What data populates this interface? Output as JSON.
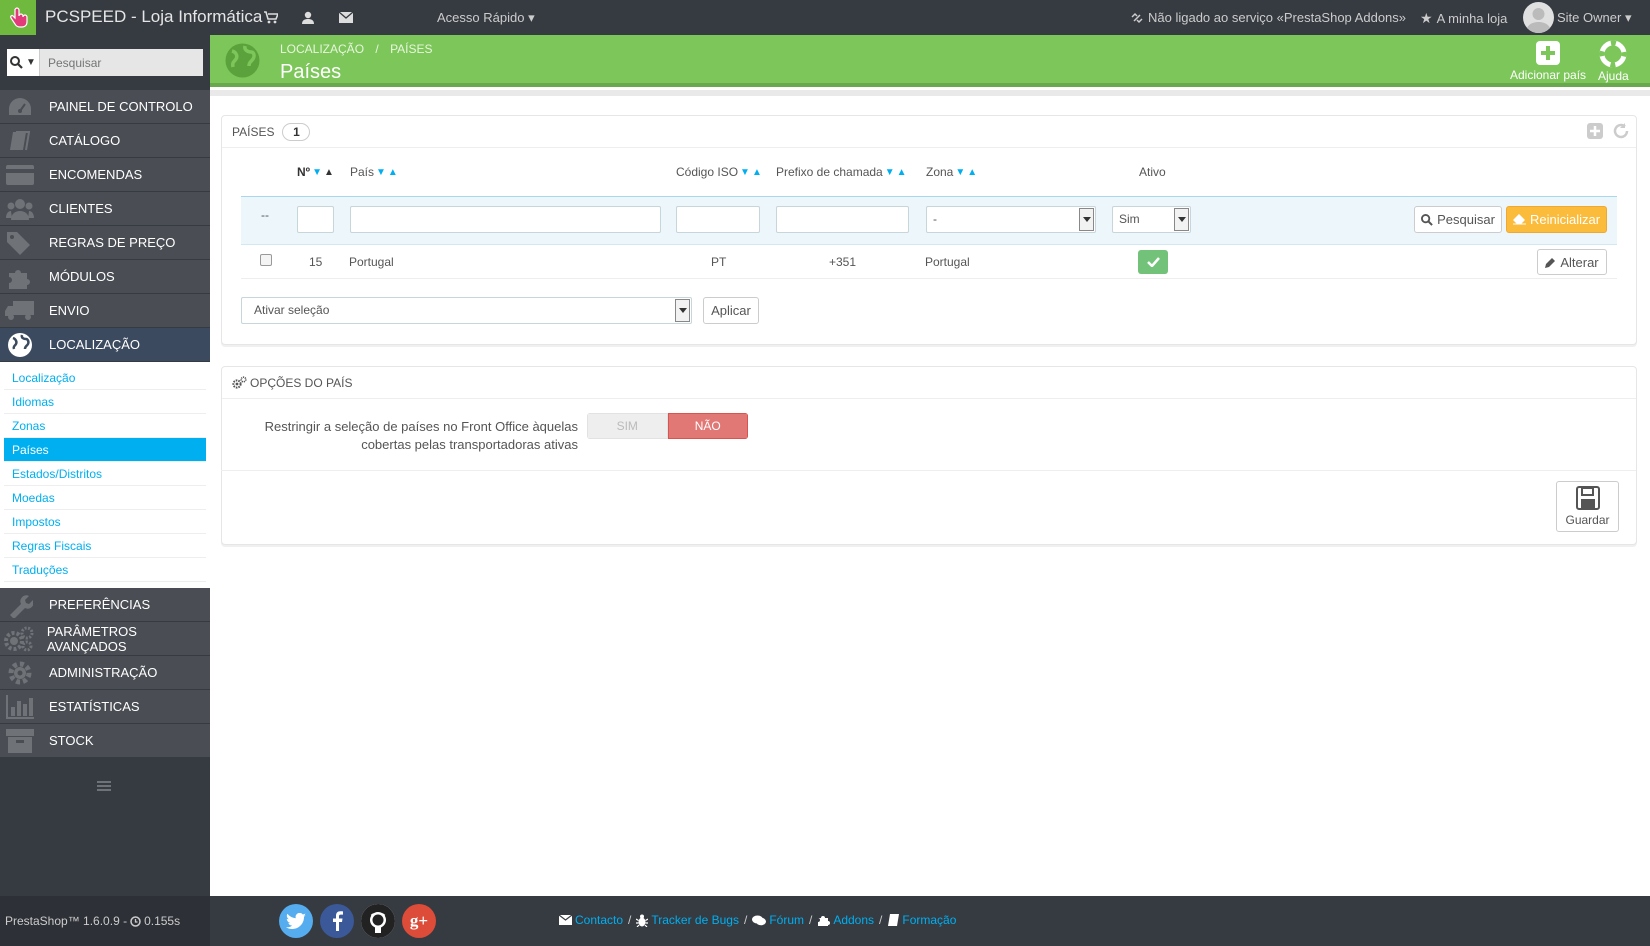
{
  "topbar": {
    "shop_name": "PCSPEED - Loja Informática",
    "quick_access": "Acesso Rápido",
    "addons_status": "Não ligado ao serviço «PrestaShop Addons»",
    "my_store": "A minha loja",
    "user": "Site Owner"
  },
  "sidebar": {
    "search_placeholder": "Pesquisar",
    "items": [
      {
        "label": "PAINEL DE CONTROLO",
        "icon": "dashboard-icon"
      },
      {
        "label": "CATÁLOGO",
        "icon": "book-icon"
      },
      {
        "label": "ENCOMENDAS",
        "icon": "credit-card-icon"
      },
      {
        "label": "CLIENTES",
        "icon": "users-icon"
      },
      {
        "label": "REGRAS DE PREÇO",
        "icon": "tags-icon"
      },
      {
        "label": "MÓDULOS",
        "icon": "puzzle-icon"
      },
      {
        "label": "ENVIO",
        "icon": "truck-icon"
      },
      {
        "label": "LOCALIZAÇÃO",
        "icon": "globe-icon"
      },
      {
        "label": "PREFERÊNCIAS",
        "icon": "wrench-icon"
      },
      {
        "label": "PARÂMETROS AVANÇADOS",
        "icon": "cogs-icon"
      },
      {
        "label": "ADMINISTRAÇÃO",
        "icon": "cog-icon"
      },
      {
        "label": "ESTATÍSTICAS",
        "icon": "bar-chart-icon"
      },
      {
        "label": "STOCK",
        "icon": "archive-icon"
      }
    ],
    "submenu": [
      "Localização",
      "Idiomas",
      "Zonas",
      "Países",
      "Estados/Distritos",
      "Moedas",
      "Impostos",
      "Regras Fiscais",
      "Traduções"
    ]
  },
  "header": {
    "breadcrumb_1": "LOCALIZAÇÃO",
    "breadcrumb_sep": "/",
    "breadcrumb_2": "PAÍSES",
    "title": "Países",
    "add_label": "Adicionar país",
    "help_label": "Ajuda"
  },
  "list": {
    "heading": "PAÍSES",
    "count": "1",
    "columns": {
      "id": "Nº",
      "country": "País",
      "iso": "Código ISO",
      "prefix": "Prefixo de chamada",
      "zone": "Zona",
      "active": "Ativo"
    },
    "filter": {
      "dash": "--",
      "zone_value": "-",
      "active_value": "Sim"
    },
    "search_btn": "Pesquisar",
    "reset_btn": "Reinicializar",
    "rows": [
      {
        "id": "15",
        "country": "Portugal",
        "iso": "PT",
        "prefix": "+351",
        "zone": "Portugal",
        "edit": "Alterar"
      }
    ],
    "bulk_value": "Ativar seleção",
    "apply_btn": "Aplicar"
  },
  "options": {
    "heading": "OPÇÕES DO PAÍS",
    "label_line1": "Restringir a seleção de países no Front Office àquelas",
    "label_line2": "cobertas pelas transportadoras ativas",
    "yes": "SIM",
    "no": "NÃO",
    "save": "Guardar"
  },
  "footer": {
    "version": "PrestaShop™ 1.6.0.9 -",
    "time": "0.155s",
    "links": [
      "Contacto",
      "Tracker de Bugs",
      "Fórum",
      "Addons",
      "Formação"
    ]
  },
  "colors": {
    "accent": "#00aff0",
    "header_green": "#7cc65a",
    "dark": "#363a41",
    "warning": "#fbbb3b",
    "danger": "#e17875"
  }
}
